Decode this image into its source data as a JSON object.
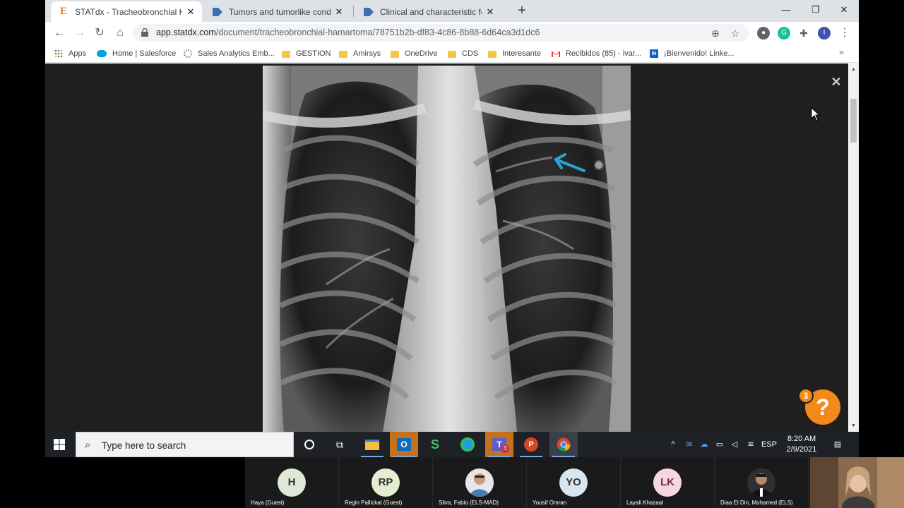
{
  "browser": {
    "tabs": [
      {
        "title": "STATdx - Tracheobronchial Hama",
        "favicon": "statdx-e-icon",
        "active": true
      },
      {
        "title": "Tumors and tumorlike conditions",
        "favicon": "doc-arrow-icon",
        "active": false
      },
      {
        "title": "Clinical and characteristic feature",
        "favicon": "doc-arrow-icon",
        "active": false
      }
    ],
    "url_host": "app.statdx.com",
    "url_path": "/document/tracheobronchial-hamartoma/78751b2b-df83-4c86-8b88-6d64ca3d1dc6",
    "profile_initial": "I",
    "bookmarks": [
      {
        "label": "Apps",
        "icon": "apps-grid-icon"
      },
      {
        "label": "Home | Salesforce",
        "icon": "salesforce-cloud-icon"
      },
      {
        "label": "Sales Analytics Emb...",
        "icon": "analytics-icon"
      },
      {
        "label": "GESTION",
        "icon": "folder-icon"
      },
      {
        "label": "Amirsys",
        "icon": "folder-icon"
      },
      {
        "label": "OneDrive",
        "icon": "folder-icon"
      },
      {
        "label": "CDS",
        "icon": "folder-icon"
      },
      {
        "label": "Interesante",
        "icon": "folder-icon"
      },
      {
        "label": "Recibidos (85) - ivar...",
        "icon": "gmail-icon"
      },
      {
        "label": "¡Bienvenido! Linke...",
        "icon": "linkedin-icon"
      }
    ]
  },
  "viewer": {
    "close_symbol": "✕",
    "help_symbol": "?",
    "help_badge_count": "3"
  },
  "taskbar": {
    "search_placeholder": "Type here to search",
    "language": "ESP",
    "time": "8:20 AM",
    "date": "2/9/2021",
    "teams_badge": "3"
  },
  "meeting": {
    "participants": [
      {
        "initials": "H",
        "name": "Haya (Guest)",
        "bg": "#dfe8d6",
        "fg": "#333333"
      },
      {
        "initials": "RP",
        "name": "Regin Pallickal (Guest)",
        "bg": "#e4ecd2",
        "fg": "#333333"
      },
      {
        "initials": "",
        "name": "Silva, Fabio (ELS-MAD)",
        "bg": "#6b8fb5",
        "fg": "#ffffff"
      },
      {
        "initials": "YO",
        "name": "Yousif Omran",
        "bg": "#d7e6ef",
        "fg": "#333333"
      },
      {
        "initials": "LK",
        "name": "Layali Khazaal",
        "bg": "#f6d6e0",
        "fg": "#7a2944"
      },
      {
        "initials": "",
        "name": "Diaa El Din, Mohamed (ELS)",
        "bg": "#3a3a3a",
        "fg": "#ffffff"
      }
    ]
  }
}
